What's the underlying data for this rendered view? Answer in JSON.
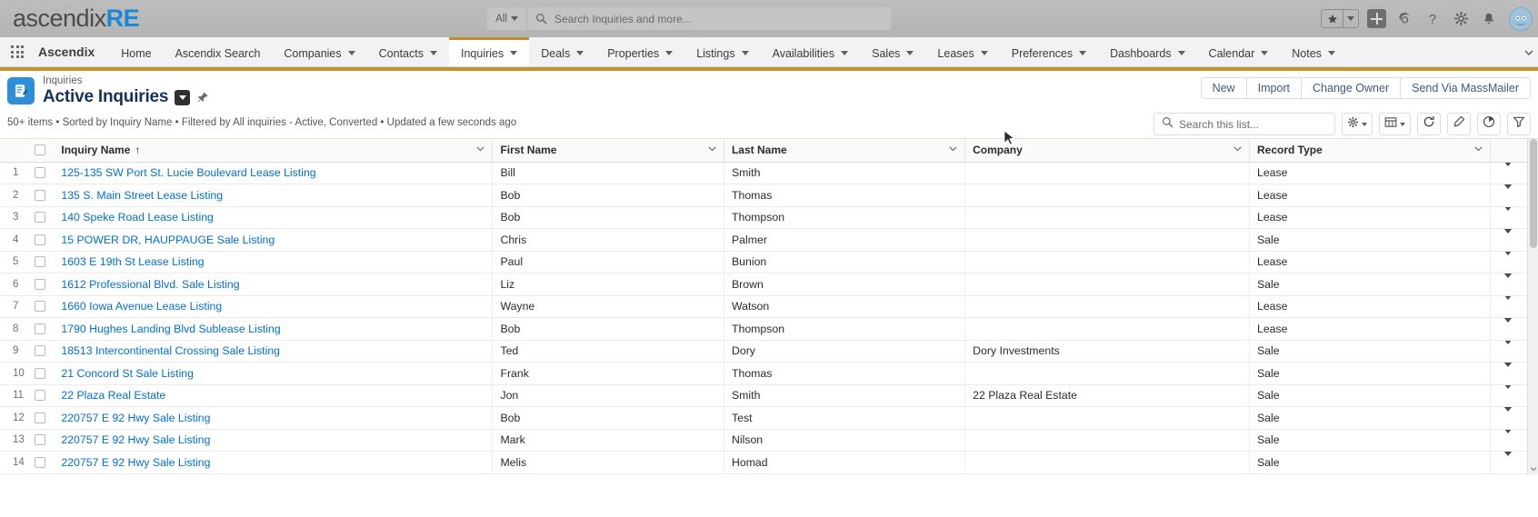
{
  "brand": {
    "logo_primary": "ascendix",
    "logo_accent": "RE",
    "logo_accent_color": "#1c88d4"
  },
  "global_search": {
    "scope_label": "All",
    "placeholder": "Search Inquiries and more...",
    "icon": "search-icon"
  },
  "global_icons": [
    {
      "name": "favorites-star-icon",
      "glyph": "★"
    },
    {
      "name": "favorites-caret-icon",
      "glyph": "▾"
    },
    {
      "name": "global-create-icon",
      "glyph": "+"
    },
    {
      "name": "setup-assistant-icon",
      "glyph": "❁"
    },
    {
      "name": "help-icon",
      "glyph": "?"
    },
    {
      "name": "setup-gear-icon",
      "glyph": "⚙"
    },
    {
      "name": "notifications-bell-icon",
      "glyph": "🔔"
    },
    {
      "name": "user-avatar",
      "glyph": "●"
    }
  ],
  "app": {
    "launcher_icon": "app-launcher-icon",
    "name": "Ascendix"
  },
  "nav": {
    "active": "Inquiries",
    "items": [
      {
        "label": "Home",
        "has_menu": false
      },
      {
        "label": "Ascendix Search",
        "has_menu": false
      },
      {
        "label": "Companies",
        "has_menu": true
      },
      {
        "label": "Contacts",
        "has_menu": true
      },
      {
        "label": "Inquiries",
        "has_menu": true
      },
      {
        "label": "Deals",
        "has_menu": true
      },
      {
        "label": "Properties",
        "has_menu": true
      },
      {
        "label": "Listings",
        "has_menu": true
      },
      {
        "label": "Availabilities",
        "has_menu": true
      },
      {
        "label": "Sales",
        "has_menu": true
      },
      {
        "label": "Leases",
        "has_menu": true
      },
      {
        "label": "Preferences",
        "has_menu": true
      },
      {
        "label": "Dashboards",
        "has_menu": true
      },
      {
        "label": "Calendar",
        "has_menu": true
      },
      {
        "label": "Notes",
        "has_menu": true
      }
    ],
    "overflow_icon": "nav-overflow-caret-icon",
    "accent_color": "#c28c2a"
  },
  "page_header": {
    "object_icon": "inquiry-object-icon",
    "object_label": "Inquiries",
    "list_view_name": "Active Inquiries",
    "list_view_caret_icon": "list-view-caret-icon",
    "pin_icon": "pin-icon",
    "buttons": [
      {
        "label": "New"
      },
      {
        "label": "Import"
      },
      {
        "label": "Change Owner"
      },
      {
        "label": "Send Via MassMailer"
      }
    ]
  },
  "list_controls": {
    "meta": "50+ items • Sorted by Inquiry Name • Filtered by All inquiries - Active, Converted • Updated a few seconds ago",
    "search_placeholder": "Search this list...",
    "buttons": [
      {
        "name": "list-view-controls-button",
        "icon": "gear-icon",
        "has_caret": true
      },
      {
        "name": "display-as-button",
        "icon": "table-icon",
        "has_caret": true
      },
      {
        "name": "refresh-button",
        "icon": "refresh-icon",
        "has_caret": false
      },
      {
        "name": "edit-button",
        "icon": "pencil-icon",
        "has_caret": false
      },
      {
        "name": "charts-button",
        "icon": "chart-icon",
        "has_caret": false
      },
      {
        "name": "filter-button",
        "icon": "filter-icon",
        "has_caret": false
      }
    ]
  },
  "table": {
    "columns": [
      {
        "key": "name",
        "label": "Inquiry Name",
        "sorted": true,
        "sort_glyph": "↑"
      },
      {
        "key": "first",
        "label": "First Name",
        "sorted": false
      },
      {
        "key": "last",
        "label": "Last Name",
        "sorted": false
      },
      {
        "key": "company",
        "label": "Company",
        "sorted": false
      },
      {
        "key": "record_type",
        "label": "Record Type",
        "sorted": false
      }
    ],
    "rows": [
      {
        "num": "1",
        "name": "125-135 SW Port St. Lucie Boulevard Lease Listing",
        "first": "Bill",
        "last": "Smith",
        "company": "",
        "record_type": "Lease"
      },
      {
        "num": "2",
        "name": "135 S. Main Street Lease Listing",
        "first": "Bob",
        "last": "Thomas",
        "company": "",
        "record_type": "Lease"
      },
      {
        "num": "3",
        "name": "140 Speke Road Lease Listing",
        "first": "Bob",
        "last": "Thompson",
        "company": "",
        "record_type": "Lease"
      },
      {
        "num": "4",
        "name": "15 POWER DR, HAUPPAUGE Sale Listing",
        "first": "Chris",
        "last": "Palmer",
        "company": "",
        "record_type": "Sale"
      },
      {
        "num": "5",
        "name": "1603 E 19th St Lease Listing",
        "first": "Paul",
        "last": "Bunion",
        "company": "",
        "record_type": "Lease"
      },
      {
        "num": "6",
        "name": "1612 Professional Blvd. Sale Listing",
        "first": "Liz",
        "last": "Brown",
        "company": "",
        "record_type": "Sale"
      },
      {
        "num": "7",
        "name": "1660 Iowa Avenue Lease Listing",
        "first": "Wayne",
        "last": "Watson",
        "company": "",
        "record_type": "Lease"
      },
      {
        "num": "8",
        "name": "1790 Hughes Landing Blvd Sublease Listing",
        "first": "Bob",
        "last": "Thompson",
        "company": "",
        "record_type": "Lease"
      },
      {
        "num": "9",
        "name": "18513 Intercontinental Crossing Sale Listing",
        "first": "Ted",
        "last": "Dory",
        "company": "Dory Investments",
        "record_type": "Sale"
      },
      {
        "num": "10",
        "name": "21 Concord St Sale Listing",
        "first": "Frank",
        "last": "Thomas",
        "company": "",
        "record_type": "Sale"
      },
      {
        "num": "11",
        "name": "22 Plaza Real Estate",
        "first": "Jon",
        "last": "Smith",
        "company": "22 Plaza Real Estate",
        "record_type": "Sale"
      },
      {
        "num": "12",
        "name": "220757 E 92 Hwy Sale Listing",
        "first": "Bob",
        "last": "Test",
        "company": "",
        "record_type": "Sale"
      },
      {
        "num": "13",
        "name": "220757 E 92 Hwy Sale Listing",
        "first": "Mark",
        "last": "Nilson",
        "company": "",
        "record_type": "Sale"
      },
      {
        "num": "14",
        "name": "220757 E 92 Hwy Sale Listing",
        "first": "Melis",
        "last": "Homad",
        "company": "",
        "record_type": "Sale"
      }
    ]
  }
}
